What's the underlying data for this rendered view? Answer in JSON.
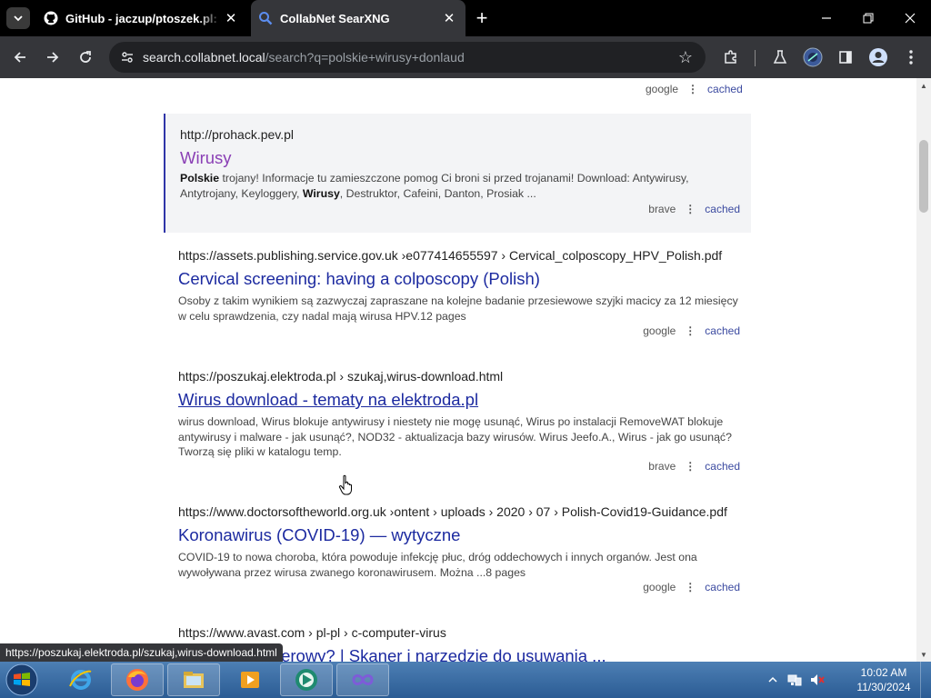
{
  "browser": {
    "tabs": [
      {
        "title": "GitHub - jaczup/ptoszek.pl: Spam",
        "active": false,
        "icon": "github-icon"
      },
      {
        "title": "CollabNet SearXNG",
        "active": true,
        "icon": "search-icon"
      }
    ],
    "new_tab": "+",
    "url_host": "search.collabnet.local",
    "url_path": "/search?q=polskie+wirusy+donlaud"
  },
  "results": [
    {
      "engine": "google",
      "cached": "cached"
    },
    {
      "url": "http://prohack.pev.pl",
      "title": "Wirusy",
      "snippet_html": "<b>Polskie</b> trojany! Informacje tu zamieszczone pomog Ci broni si przed trojanami! Download: Antywirusy, Antytrojany, Keyloggery, <b>Wirusy</b>, Destruktor, Cafeini, Danton, Prosiak ...",
      "engine": "brave",
      "cached": "cached"
    },
    {
      "url": "https://assets.publishing.service.gov.uk ›e077414655597 › Cervical_colposcopy_HPV_Polish.pdf",
      "title": "Cervical screening: having a colposcopy (Polish)",
      "snippet": "Osoby z takim wynikiem są zazwyczaj zapraszane na kolejne badanie przesiewowe szyjki macicy za 12 miesięcy w celu sprawdzenia, czy nadal mają wirusa HPV.12 pages",
      "engine": "google",
      "cached": "cached"
    },
    {
      "url": "https://poszukaj.elektroda.pl  › szukaj,wirus-download.html",
      "title": "Wirus download - tematy na elektroda.pl",
      "snippet": "wirus download, Wirus blokuje antywirusy i niestety nie mogę usunąć, Wirus po instalacji RemoveWAT blokuje antywirusy i malware - jak usunąć?, NOD32 - aktualizacja bazy wirusów. Wirus Jeefo.A., Wirus - jak go usunąć? Tworzą się pliki w katalogu temp.",
      "engine": "brave",
      "cached": "cached"
    },
    {
      "url": "https://www.doctorsoftheworld.org.uk ›ontent › uploads › 2020 › 07 › Polish-Covid19-Guidance.pdf",
      "title": "Koronawirus (COVID-19) — wytyczne",
      "snippet": "COVID-19 to nowa choroba, która powoduje infekcję płuc, dróg oddechowych i innych organów. Jest ona wywoływana przez wirusa zwanego koronawirusem. Można ...8 pages",
      "engine": "google",
      "cached": "cached"
    },
    {
      "url": "https://www.avast.com  › pl-pl › c-computer-virus",
      "title": "Wirus komputerowy? | Skaner i narzędzie do usuwania ..."
    }
  ],
  "status_bar": "https://poszukaj.elektroda.pl/szukaj,wirus-download.html",
  "taskbar": {
    "time": "10:02 AM",
    "date": "11/30/2024",
    "apps": [
      "internet-explorer-icon",
      "firefox-icon",
      "file-explorer-icon",
      "media-player-icon",
      "chrome-like-icon",
      "infinity-icon"
    ]
  },
  "colors": {
    "link": "#1c2aa0",
    "visited": "#8a3fb5",
    "highlight_border": "#2f35a8"
  }
}
